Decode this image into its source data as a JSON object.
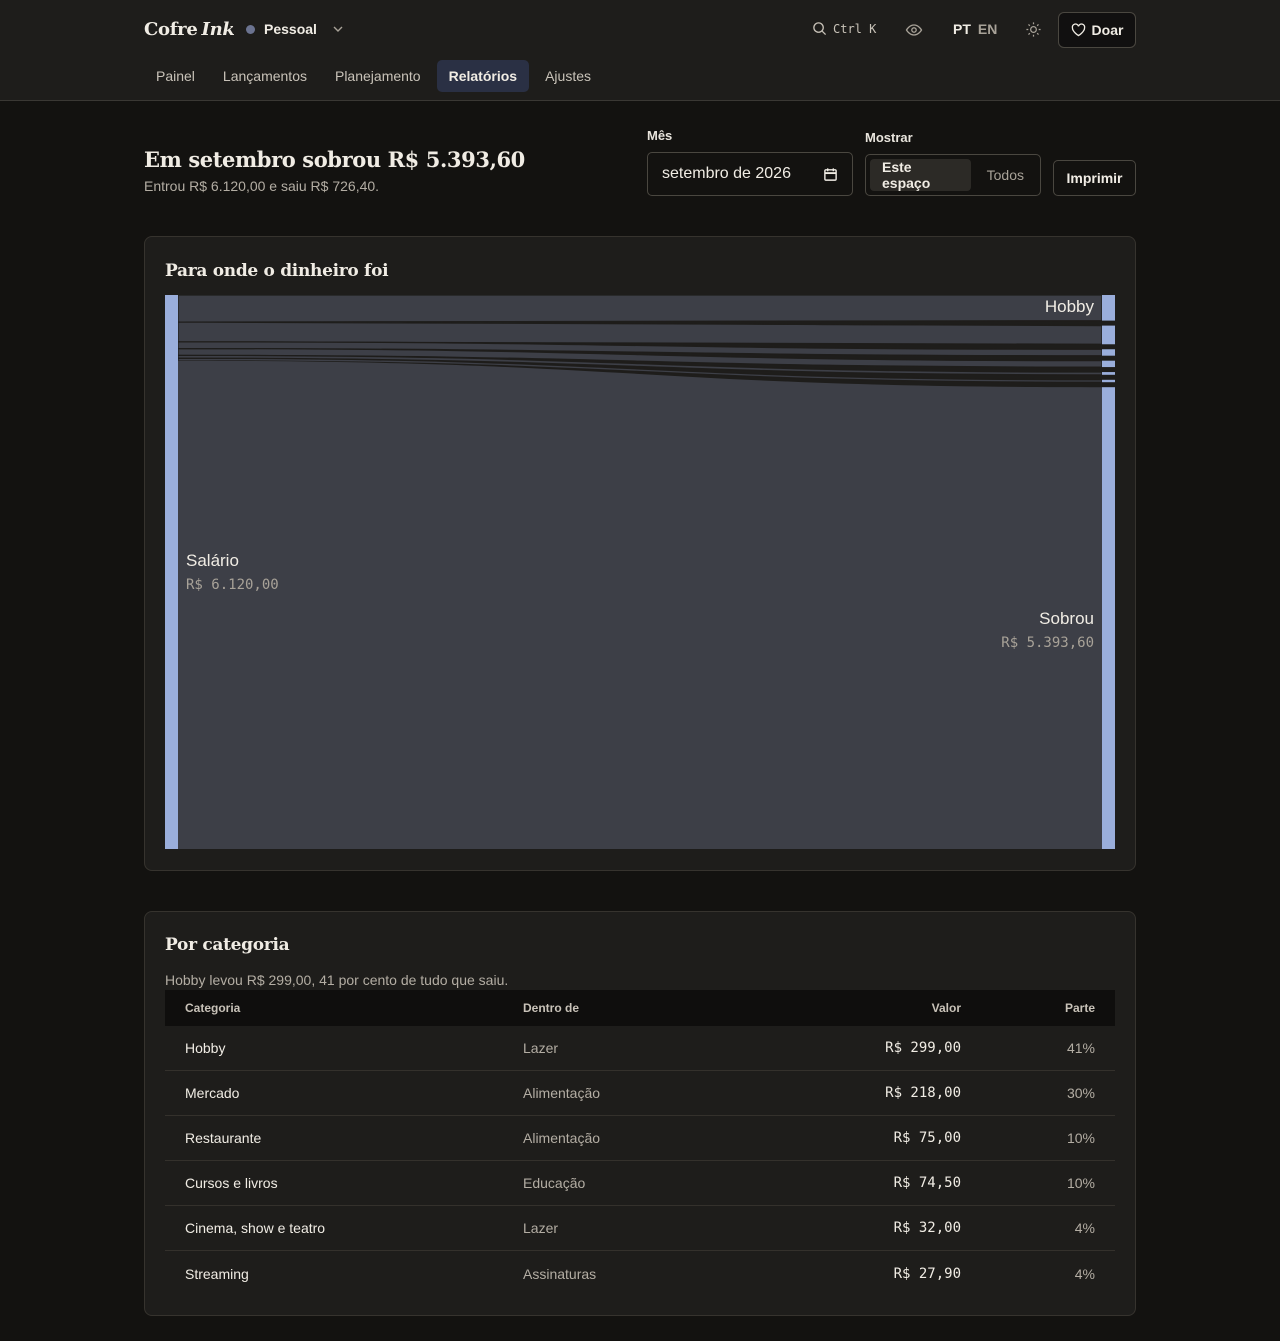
{
  "header": {
    "brand_main": "Cofre",
    "brand_ink": "Ink",
    "space_name": "Pessoal",
    "search_shortcut": "Ctrl K",
    "lang_active": "PT",
    "lang_other": "EN",
    "donate_label": "Doar"
  },
  "nav": {
    "tabs": [
      {
        "label": "Painel"
      },
      {
        "label": "Lançamentos"
      },
      {
        "label": "Planejamento"
      },
      {
        "label": "Relatórios",
        "active": true
      },
      {
        "label": "Ajustes"
      }
    ]
  },
  "summary": {
    "headline": "Em setembro sobrou R$ 5.393,60",
    "subline": "Entrou R$ 6.120,00 e saiu R$ 726,40."
  },
  "filters": {
    "month_label": "Mês",
    "month_value": "setembro de 2026",
    "show_label": "Mostrar",
    "show_this": "Este espaço",
    "show_all": "Todos",
    "print_label": "Imprimir"
  },
  "sankey_card": {
    "title": "Para onde o dinheiro foi",
    "source_name": "Salário",
    "source_value": "R$ 6.120,00",
    "top_target_label": "Hobby",
    "rest_name": "Sobrou",
    "rest_value": "R$ 5.393,60",
    "colors": {
      "node": "#9aaedb",
      "link": "#3d3f47",
      "bg": "#1e1d1b"
    },
    "flows": [
      {
        "name": "Hobby",
        "value": 299.0
      },
      {
        "name": "Mercado",
        "value": 218.0
      },
      {
        "name": "Restaurante",
        "value": 75.0
      },
      {
        "name": "Cursos e livros",
        "value": 74.5
      },
      {
        "name": "Cinema, show e teatro",
        "value": 32.0
      },
      {
        "name": "Streaming",
        "value": 27.9
      },
      {
        "name": "Sobrou",
        "value": 5393.6
      }
    ]
  },
  "category_card": {
    "title": "Por categoria",
    "note": "Hobby levou R$ 299,00, 41 por cento de tudo que saiu.",
    "columns": [
      "Categoria",
      "Dentro de",
      "Valor",
      "Parte"
    ],
    "rows": [
      {
        "category": "Hobby",
        "parent": "Lazer",
        "value": "R$ 299,00",
        "share": "41%"
      },
      {
        "category": "Mercado",
        "parent": "Alimentação",
        "value": "R$ 218,00",
        "share": "30%"
      },
      {
        "category": "Restaurante",
        "parent": "Alimentação",
        "value": "R$ 75,00",
        "share": "10%"
      },
      {
        "category": "Cursos e livros",
        "parent": "Educação",
        "value": "R$ 74,50",
        "share": "10%"
      },
      {
        "category": "Cinema, show e teatro",
        "parent": "Lazer",
        "value": "R$ 32,00",
        "share": "4%"
      },
      {
        "category": "Streaming",
        "parent": "Assinaturas",
        "value": "R$ 27,90",
        "share": "4%"
      }
    ]
  }
}
